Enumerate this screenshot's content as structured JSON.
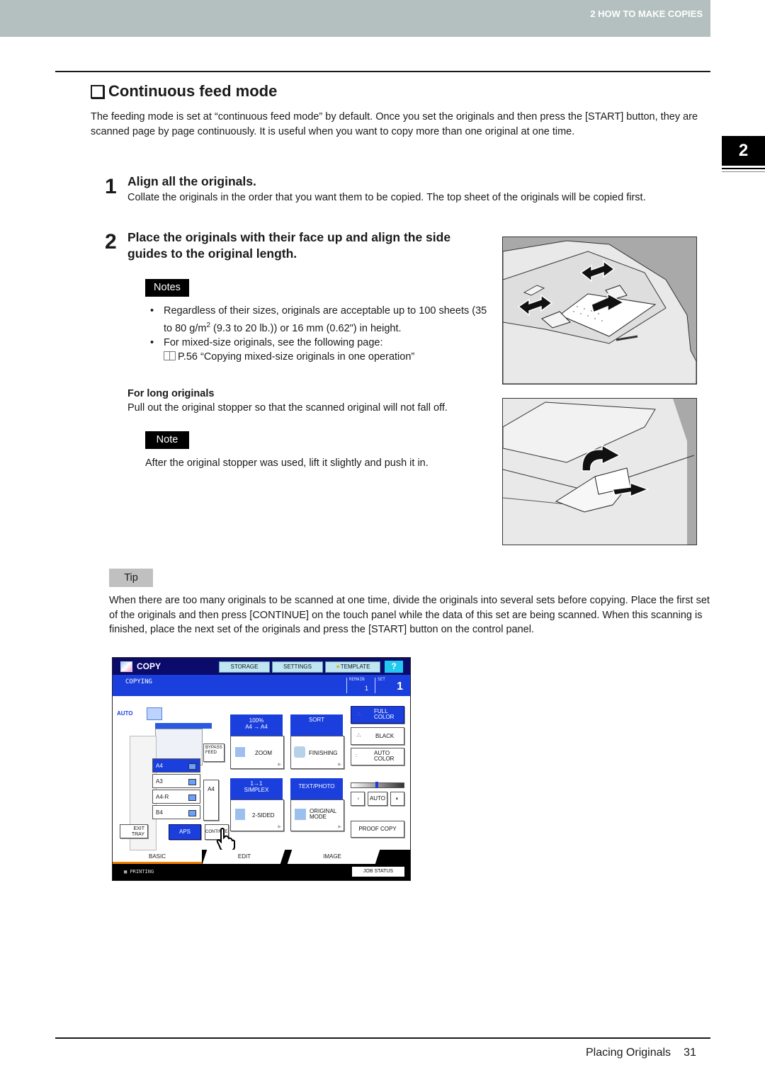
{
  "header": {
    "chapter_label": "2 HOW TO MAKE COPIES",
    "chapter_tab": "2"
  },
  "section": {
    "title": "Continuous feed mode",
    "intro": "The feeding mode is set at “continuous feed mode” by default. Once you set the originals and then press the [START] button, they are scanned page by page continuously. It is useful when you want to copy more than one original at one time."
  },
  "steps": [
    {
      "number": "1",
      "title": "Align all the originals.",
      "body": "Collate the originals in the order that you want them to be copied. The top sheet of the originals will be copied first."
    },
    {
      "number": "2",
      "title": "Place the originals with their face up and align the side guides to the original length."
    }
  ],
  "notes": {
    "label": "Notes",
    "items": [
      {
        "bullet": "•",
        "text_before_sup": "Regardless of their sizes, originals are acceptable up to 100 sheets (35 to 80 g/m",
        "sup": "2",
        "text_after_sup": " (9.3 to 20 lb.)) or 16 mm (0.62\") in height."
      },
      {
        "bullet": "•",
        "text": "For mixed-size originals, see the following page:"
      }
    ],
    "reference": "P.56 “Copying mixed-size originals in one operation”"
  },
  "long_originals": {
    "title": "For long originals",
    "body": "Pull out the original stopper so that the scanned original will not fall off.",
    "note_label": "Note",
    "note_body": "After the original stopper was used, lift it slightly and push it in."
  },
  "tip": {
    "label": "Tip",
    "body": "When there are too many originals to be scanned at one time, divide the originals into several sets before copying. Place the first set of the originals and then press [CONTINUE] on the touch panel while the data of this set are being scanned. When this scanning is finished, place the next set of the originals and press the [START] button on the control panel."
  },
  "touch_panel": {
    "app_title": "COPY",
    "top_buttons": [
      "STORAGE",
      "SETTINGS",
      "TEMPLATE"
    ],
    "help": "?",
    "status": "COPYING",
    "remain_label": "REMAIN",
    "remain_value": "1",
    "set_label": "SET",
    "set_value": "1",
    "auto_label": "AUTO",
    "bypass_label": "BYPASS FEED",
    "trays": [
      "A4",
      "A3",
      "A4-R",
      "B4"
    ],
    "selected_tray": "A4",
    "bypass_size": "A4",
    "exit_tray": "EXIT TRAY",
    "aps": "APS",
    "continue": "CONTINUE",
    "zoom": {
      "header_line1": "100%",
      "header_line2": "A4 → A4",
      "label": "ZOOM"
    },
    "finishing": {
      "header": "SORT",
      "label": "FINISHING"
    },
    "two_sided": {
      "header_line1": "1→1",
      "header_line2": "SIMPLEX",
      "label": "2-SIDED"
    },
    "original_mode": {
      "header": "TEXT/PHOTO",
      "label": "ORIGINAL MODE"
    },
    "color_modes": [
      "FULL COLOR",
      "BLACK",
      "AUTO COLOR"
    ],
    "selected_color_mode": "FULL COLOR",
    "density_auto": "AUTO",
    "proof_copy": "PROOF COPY",
    "tabs": [
      "BASIC",
      "EDIT",
      "IMAGE"
    ],
    "active_tab": "BASIC",
    "bottom_status": "PRINTING",
    "job_status": "JOB STATUS"
  },
  "footer": {
    "section": "Placing Originals",
    "page": "31"
  }
}
